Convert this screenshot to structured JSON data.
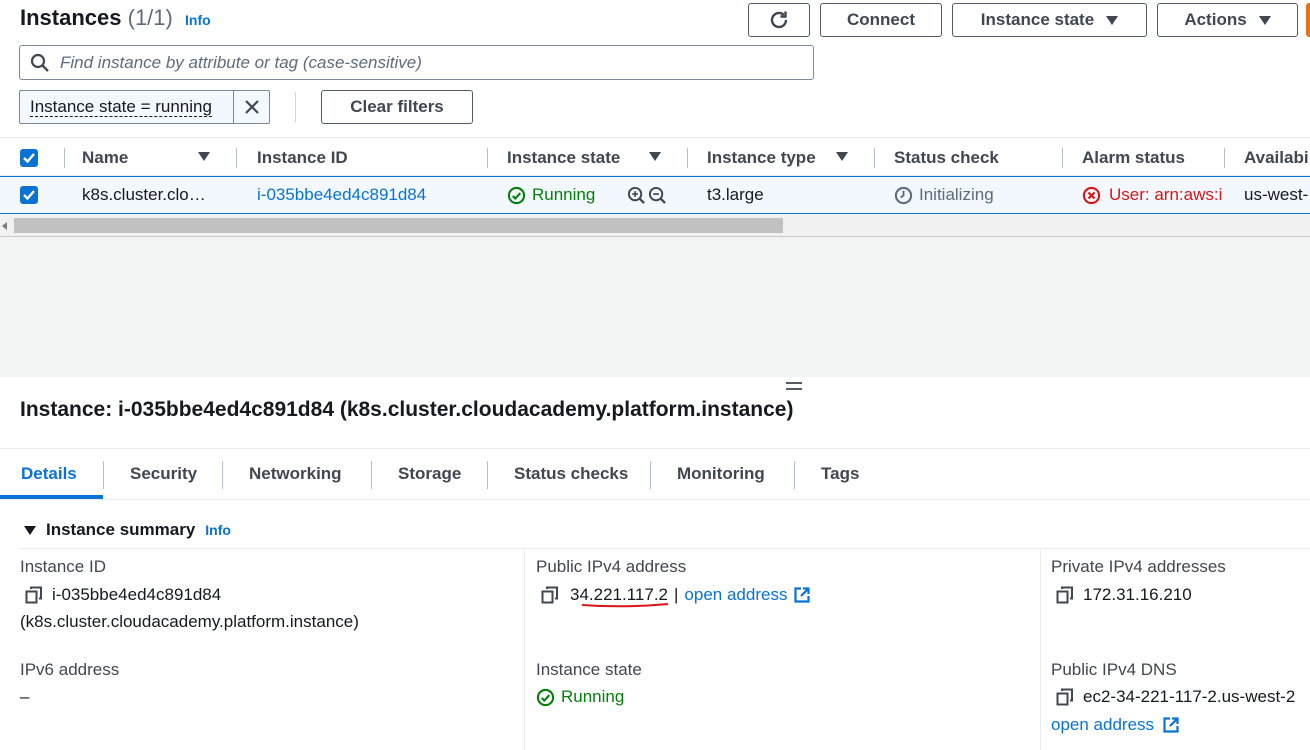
{
  "header": {
    "title": "Instances",
    "count": "(1/1)",
    "info": "Info",
    "connect": "Connect",
    "instance_state": "Instance state",
    "actions": "Actions"
  },
  "search": {
    "placeholder": "Find instance by attribute or tag (case-sensitive)"
  },
  "filter_chip": {
    "label": "Instance state = running"
  },
  "clear_filters": "Clear filters",
  "table": {
    "columns": [
      "Name",
      "Instance ID",
      "Instance state",
      "Instance type",
      "Status check",
      "Alarm status",
      "Availabi"
    ],
    "row": {
      "name": "k8s.cluster.clo…",
      "instance_id": "i-035bbe4ed4c891d84",
      "state": "Running",
      "type": "t3.large",
      "status_check": "Initializing",
      "alarm": "User: arn:aws:i",
      "availability": "us-west-"
    }
  },
  "detail": {
    "title": "Instance: i-035bbe4ed4c891d84 (k8s.cluster.cloudacademy.platform.instance)",
    "tabs": [
      "Details",
      "Security",
      "Networking",
      "Storage",
      "Status checks",
      "Monitoring",
      "Tags"
    ],
    "summary_title": "Instance summary",
    "summary_info": "Info",
    "fields": {
      "instance_id_label": "Instance ID",
      "instance_id_value": "i-035bbe4ed4c891d84",
      "instance_id_name": "(k8s.cluster.cloudacademy.platform.instance)",
      "public_ipv4_label": "Public IPv4 address",
      "public_ipv4_value": "34.221.117.2",
      "public_ipv4_sep": "|",
      "open_address": "open address",
      "private_ipv4_label": "Private IPv4 addresses",
      "private_ipv4_value": "172.31.16.210",
      "ipv6_label": "IPv6 address",
      "ipv6_value": "–",
      "state_label": "Instance state",
      "state_value": "Running",
      "public_dns_label": "Public IPv4 DNS",
      "public_dns_value": "ec2-34-221-117-2.us-west-2",
      "public_dns_open": "open address"
    }
  },
  "colors": {
    "accent": "#0972d3",
    "running": "#037f0c",
    "alarm": "#d91515",
    "annotation": "#d91515"
  }
}
